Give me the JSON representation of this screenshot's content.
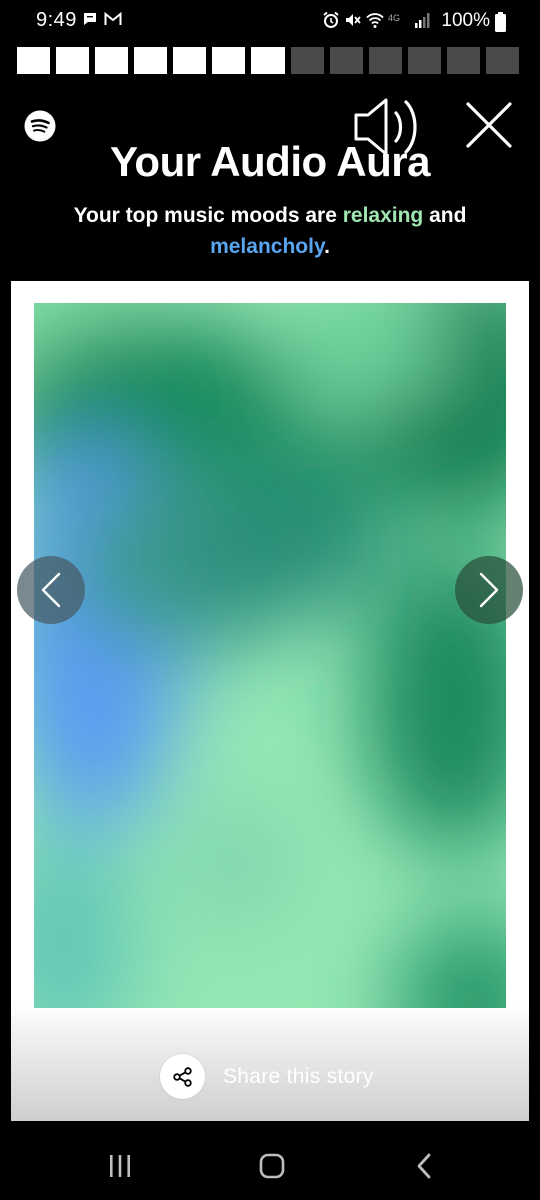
{
  "status_bar": {
    "time": "9:49",
    "battery": "100%",
    "icons": [
      "chat-icon",
      "gmail-icon",
      "alarm-icon",
      "mute-icon",
      "wifi-icon",
      "4g-icon",
      "signal-icon",
      "battery-icon"
    ]
  },
  "progress": {
    "total_segments": 13,
    "completed_segments": 7
  },
  "header": {
    "logo_icon": "spotify-logo-icon",
    "sound_icon": "volume-icon",
    "close_icon": "close-icon",
    "title": "Your Audio Aura",
    "subtitle_prefix": "Your top music moods are ",
    "mood_1": "relaxing",
    "subtitle_middle": " and ",
    "mood_2": "melancholy",
    "subtitle_suffix": "."
  },
  "colors": {
    "mood_1": "#9fe6b2",
    "mood_2": "#5aa5f0",
    "aura_green_dark": "#138a5c",
    "aura_green_light": "#93e7b4",
    "aura_blue": "#5b9cf0"
  },
  "card": {
    "share_label": "Share this story",
    "share_icon": "share-icon"
  },
  "nav": {
    "prev_icon": "chevron-left-icon",
    "next_icon": "chevron-right-icon"
  },
  "android_nav": {
    "recents_icon": "recents-icon",
    "home_icon": "home-icon",
    "back_icon": "back-icon"
  }
}
